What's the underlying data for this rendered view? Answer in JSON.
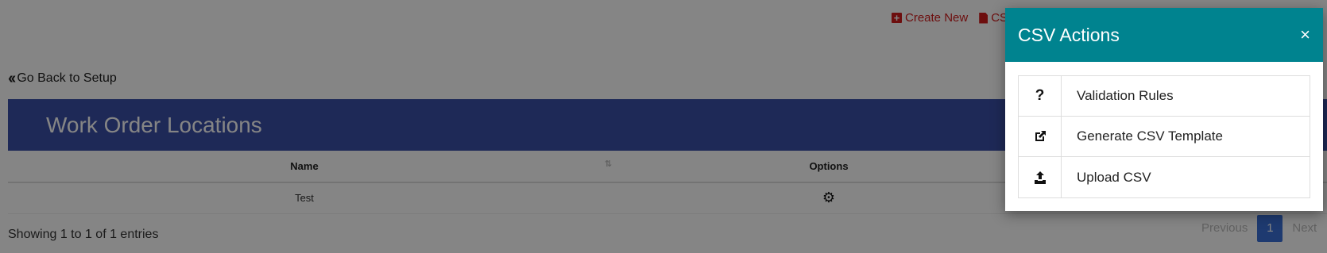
{
  "top_actions": {
    "create_new": "Create New",
    "csv": "CSV"
  },
  "back_link": "Go Back to Setup",
  "panel": {
    "title": "Work Order Locations"
  },
  "table": {
    "headers": [
      "Name",
      "Options"
    ],
    "rows": [
      {
        "name": "Test"
      }
    ]
  },
  "footer": {
    "showing": "Showing 1 to 1 of 1 entries"
  },
  "pagination": {
    "previous": "Previous",
    "current": "1",
    "next": "Next"
  },
  "modal": {
    "title": "CSV Actions",
    "close": "×",
    "actions": [
      {
        "label": "Validation Rules",
        "icon": "question-icon"
      },
      {
        "label": "Generate CSV Template",
        "icon": "external-link-icon"
      },
      {
        "label": "Upload CSV",
        "icon": "upload-icon"
      }
    ]
  },
  "colors": {
    "panel_header": "#3a4fa8",
    "modal_header": "#00838f",
    "action_red": "#d11c1c",
    "page_active": "#3a6fd6"
  }
}
